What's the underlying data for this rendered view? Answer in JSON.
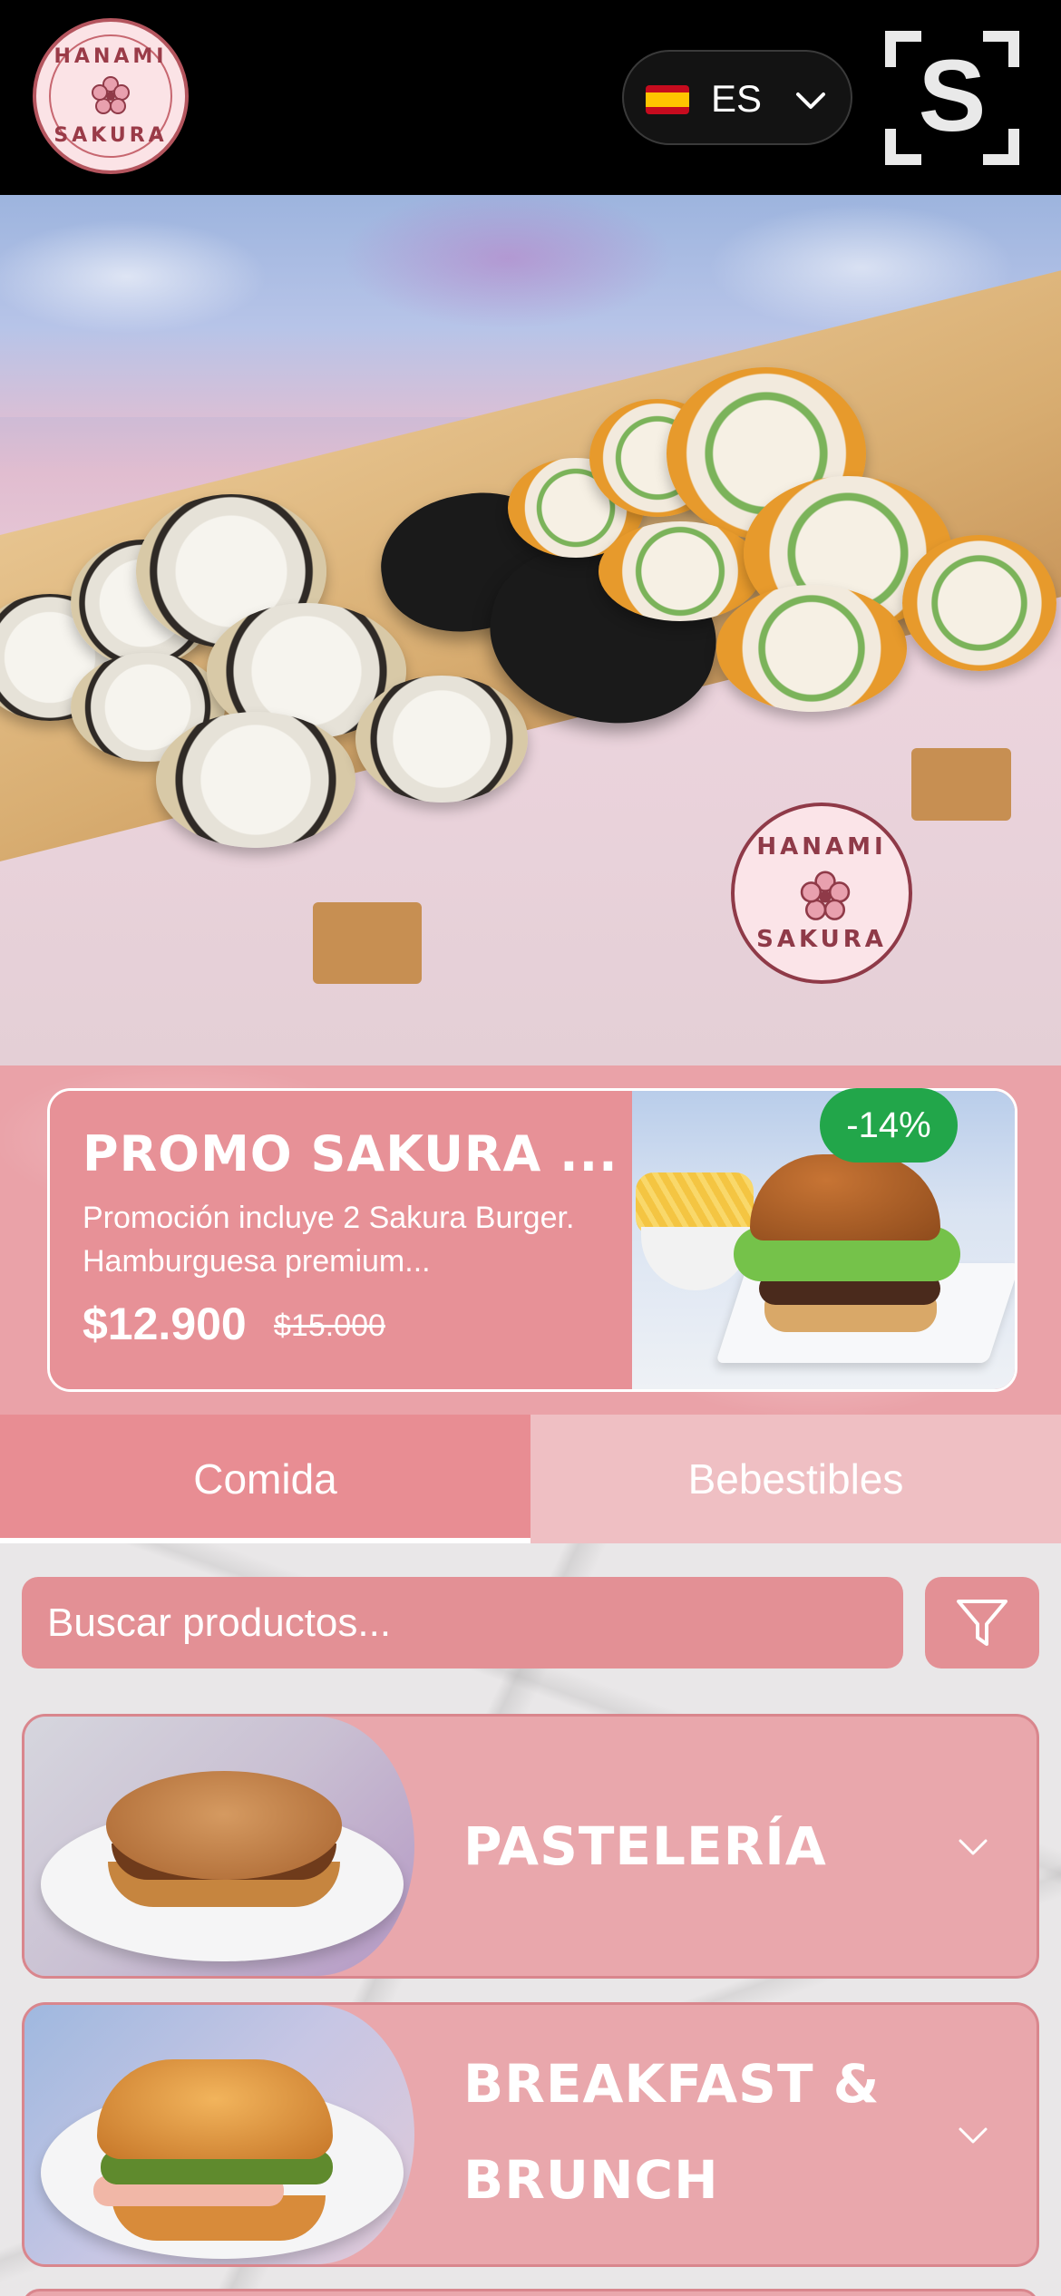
{
  "header": {
    "logo_text_top": "HANAMI",
    "logo_text_bottom": "SAKURA",
    "language": {
      "code": "ES",
      "flag_icon": "spain-flag-icon"
    },
    "brand_letter": "S"
  },
  "hero": {
    "stamp_text_top": "HANAMI",
    "stamp_text_bottom": "SAKURA"
  },
  "promo": {
    "title": "PROMO SAKURA ...",
    "description": "Promoción incluye 2 Sakura Burger. Hamburguesa premium...",
    "price": "$12.900",
    "old_price": "$15.000",
    "discount_badge": "-14%",
    "badge_color": "#22a64a"
  },
  "tabs": [
    {
      "label": "Comida",
      "active": true
    },
    {
      "label": "Bebestibles",
      "active": false
    }
  ],
  "search": {
    "placeholder": "Buscar productos...",
    "value": ""
  },
  "categories": [
    {
      "title": "PASTELERÍA"
    },
    {
      "title": "BREAKFAST & BRUNCH"
    }
  ],
  "colors": {
    "accent": "#e88d93",
    "tab_inactive": "#efbfc3",
    "card": "#e9a7ac"
  }
}
